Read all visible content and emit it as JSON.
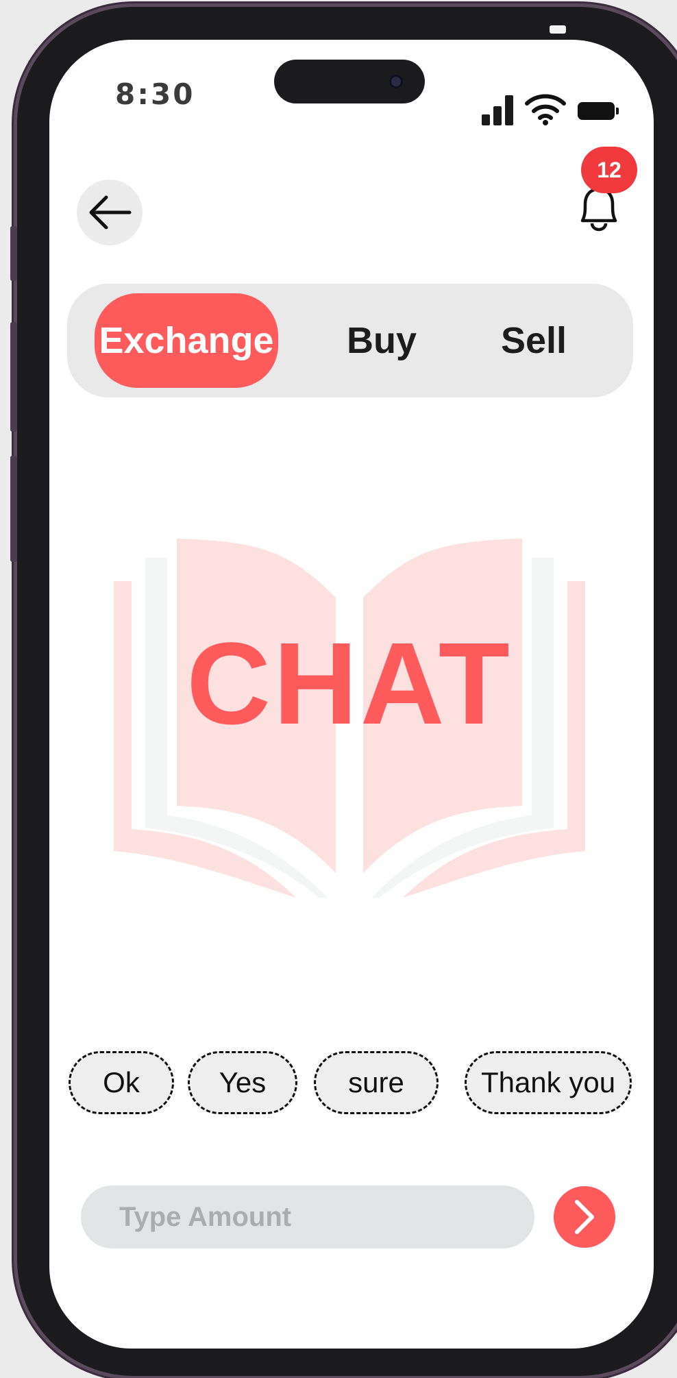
{
  "status_bar": {
    "time": "8:30",
    "icons": [
      "signal-icon",
      "wifi-icon",
      "battery-icon"
    ]
  },
  "header": {
    "back_icon": "arrow-left-icon",
    "notification_icon": "bell-icon",
    "notification_count": "12"
  },
  "tabs": [
    {
      "label": "Exchange",
      "active": true
    },
    {
      "label": "Buy",
      "active": false
    },
    {
      "label": "Sell",
      "active": false
    }
  ],
  "hero": {
    "text": "CHAT",
    "icon": "open-book-icon"
  },
  "quick_replies": [
    "Ok",
    "Yes",
    "sure",
    "Thank you"
  ],
  "composer": {
    "placeholder": "Type Amount",
    "value": "",
    "send_icon": "chevron-right-icon"
  },
  "colors": {
    "accent": "#ff5a5c",
    "badge": "#f03a3e",
    "book_tint": "#fde0e0"
  }
}
